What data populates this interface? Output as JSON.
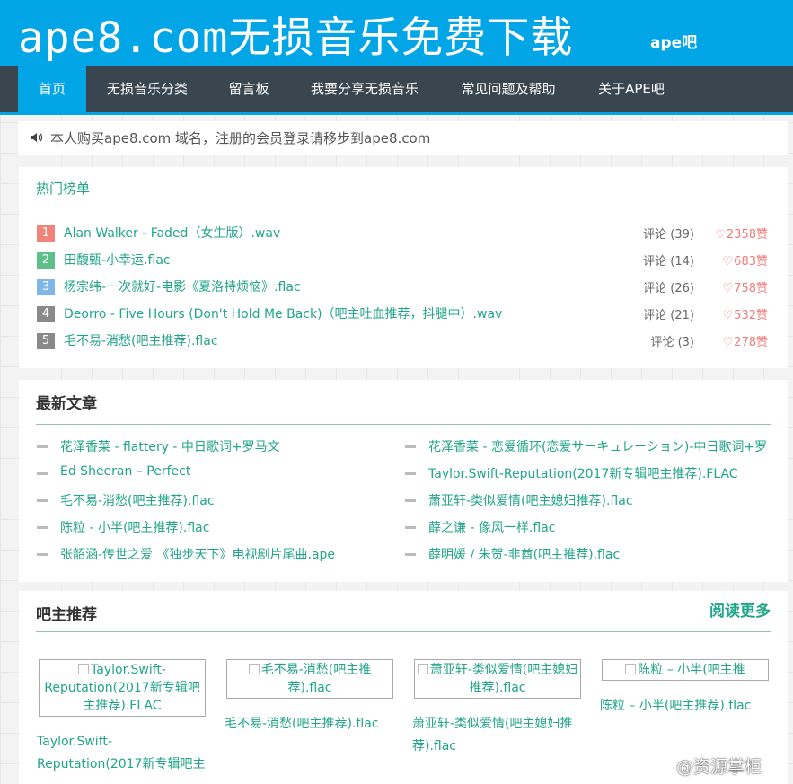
{
  "header": {
    "site_title": "ape8.com无损音乐免费下载",
    "site_sub": "ape吧"
  },
  "nav": {
    "items": [
      {
        "label": "首页",
        "active": true
      },
      {
        "label": "无损音乐分类"
      },
      {
        "label": "留言板"
      },
      {
        "label": "我要分享无损音乐"
      },
      {
        "label": "常见问题及帮助"
      },
      {
        "label": "关于APE吧"
      }
    ]
  },
  "notice": {
    "icon": "speaker-icon",
    "text": "本人购买ape8.com 域名，注册的会员登录请移步到ape8.com"
  },
  "hot": {
    "title": "热门榜单",
    "items": [
      {
        "rank": "1",
        "rank_color": "#f0837a",
        "title": "Alan Walker - Faded（女生版）.wav",
        "comments": "评论 (39)",
        "likes": "2358赞"
      },
      {
        "rank": "2",
        "rank_color": "#5fbf8b",
        "title": "田馥甄-小幸运.flac",
        "comments": "评论 (14)",
        "likes": "683赞"
      },
      {
        "rank": "3",
        "rank_color": "#7fb6e8",
        "title": "杨宗纬-一次就好-电影《夏洛特烦恼》.flac",
        "comments": "评论 (26)",
        "likes": "758赞"
      },
      {
        "rank": "4",
        "rank_color": "#8a8a8a",
        "title": "Deorro - Five Hours (Don't Hold Me Back)（吧主吐血推荐，抖腿中）.wav",
        "comments": "评论 (21)",
        "likes": "532赞"
      },
      {
        "rank": "5",
        "rank_color": "#8a8a8a",
        "title": "毛不易-消愁(吧主推荐).flac",
        "comments": "评论 (3)",
        "likes": "278赞"
      }
    ]
  },
  "latest": {
    "title": "最新文章",
    "left": [
      "花泽香菜 - flattery - 中日歌词+罗马文",
      "Ed Sheeran – Perfect",
      "毛不易-消愁(吧主推荐).flac",
      "陈粒 - 小半(吧主推荐).flac",
      "张韶涵-传世之爱 《独步天下》电视剧片尾曲.ape"
    ],
    "right": [
      "花泽香菜 - 恋爱循环(恋爱サーキュレーション)-中日歌词+罗",
      "Taylor.Swift-Reputation(2017新专辑吧主推荐).FLAC",
      "萧亚轩-类似爱情(吧主媳妇推荐).flac",
      "薛之谦 - 像风一样.flac",
      "薛明媛 / 朱贺-非酋(吧主推荐).flac"
    ]
  },
  "recommend": {
    "title": "吧主推荐",
    "more": "阅读更多",
    "items": [
      {
        "img_alt": "Taylor.Swift-Reputation(2017新专辑吧主推荐).FLAC",
        "caption": "Taylor.Swift-Reputation(2017新专辑吧主"
      },
      {
        "img_alt": "毛不易-消愁(吧主推荐).flac",
        "caption": "毛不易-消愁(吧主推荐).flac"
      },
      {
        "img_alt": "萧亚轩-类似爱情(吧主媳妇推荐).flac",
        "caption": "萧亚轩-类似爱情(吧主媳妇推荐).flac"
      },
      {
        "img_alt": "陈粒 – 小半(吧主推荐).flac",
        "caption": "陈粒 – 小半(吧主推荐).flac"
      }
    ]
  },
  "watermark": "@资源掌柜"
}
